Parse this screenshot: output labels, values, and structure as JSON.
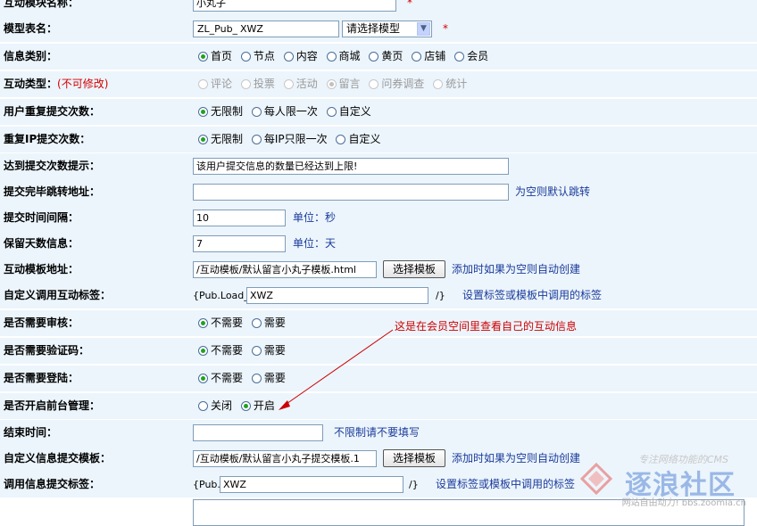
{
  "colors": {
    "row_bg": "#ecf5fc",
    "required": "#d40000",
    "hint": "#1a3a9a",
    "annotation": "#cc0000"
  },
  "rows": [
    {
      "label": "互动模块名称：",
      "value": "小丸子",
      "required": "*"
    },
    {
      "label": "模型表名：",
      "prefix": "ZL_Pub_",
      "value": "XWZ",
      "select_value": "请选择模型",
      "required": "*"
    },
    {
      "label": "信息类别：",
      "options": [
        "首页",
        "节点",
        "内容",
        "商城",
        "黄页",
        "店铺",
        "会员"
      ],
      "selected": "首页"
    },
    {
      "label": "互动类型：",
      "note": "(不可修改)",
      "options": [
        "评论",
        "投票",
        "活动",
        "留言",
        "问券调查",
        "统计"
      ],
      "selected": "留言"
    },
    {
      "label": "用户重复提交次数：",
      "options": [
        "无限制",
        "每人限一次",
        "自定义"
      ],
      "selected": "无限制"
    },
    {
      "label": "重复IP提交次数：",
      "options": [
        "无限制",
        "每IP只限一次",
        "自定义"
      ],
      "selected": "无限制"
    },
    {
      "label": "达到提交次数提示：",
      "value": "该用户提交信息的数量已经达到上限!"
    },
    {
      "label": "提交完毕跳转地址：",
      "value": "",
      "hint": "为空则默认跳转"
    },
    {
      "label": "提交时间间隔：",
      "value": "10",
      "hint": "单位：秒"
    },
    {
      "label": "保留天数信息：",
      "value": "7",
      "hint": "单位：天"
    },
    {
      "label": "互动模板地址：",
      "value": "/互动模板/默认留言小丸子模板.html",
      "button": "选择模板",
      "hint": "添加时如果为空则自动创建"
    },
    {
      "label": "自定义调用互动标签：",
      "prefix": "{Pub.Load_",
      "value": "XWZ",
      "suffix": "/}",
      "hint": "设置标签或模板中调用的标签"
    },
    {
      "label": "是否需要审核：",
      "options": [
        "不需要",
        "需要"
      ],
      "selected": "不需要"
    },
    {
      "label": "是否需要验证码：",
      "options": [
        "不需要",
        "需要"
      ],
      "selected": "不需要"
    },
    {
      "label": "是否需要登陆：",
      "options": [
        "不需要",
        "需要"
      ],
      "selected": "不需要"
    },
    {
      "label": "是否开启前台管理：",
      "options": [
        "关闭",
        "开启"
      ],
      "selected": "开启"
    },
    {
      "label": "结束时间：",
      "value": "",
      "hint": "不限制请不要填写"
    },
    {
      "label": "自定义信息提交模板：",
      "value": "/互动模板/默认留言小丸子提交模板.1",
      "button": "选择模板",
      "hint": "添加时如果为空则自动创建"
    },
    {
      "label": "调用信息提交标签：",
      "prefix": "{Pub.",
      "value": "XWZ",
      "suffix": "/}",
      "hint": "设置标签或模板中调用的标签"
    }
  ],
  "annotation": "这是在会员空间里查看自己的互动信息",
  "watermark": {
    "tagline": "专注网络功能的CMS",
    "brand": "逐浪社区",
    "footer": "网站自由动力! bbs.zoomla.cn"
  }
}
